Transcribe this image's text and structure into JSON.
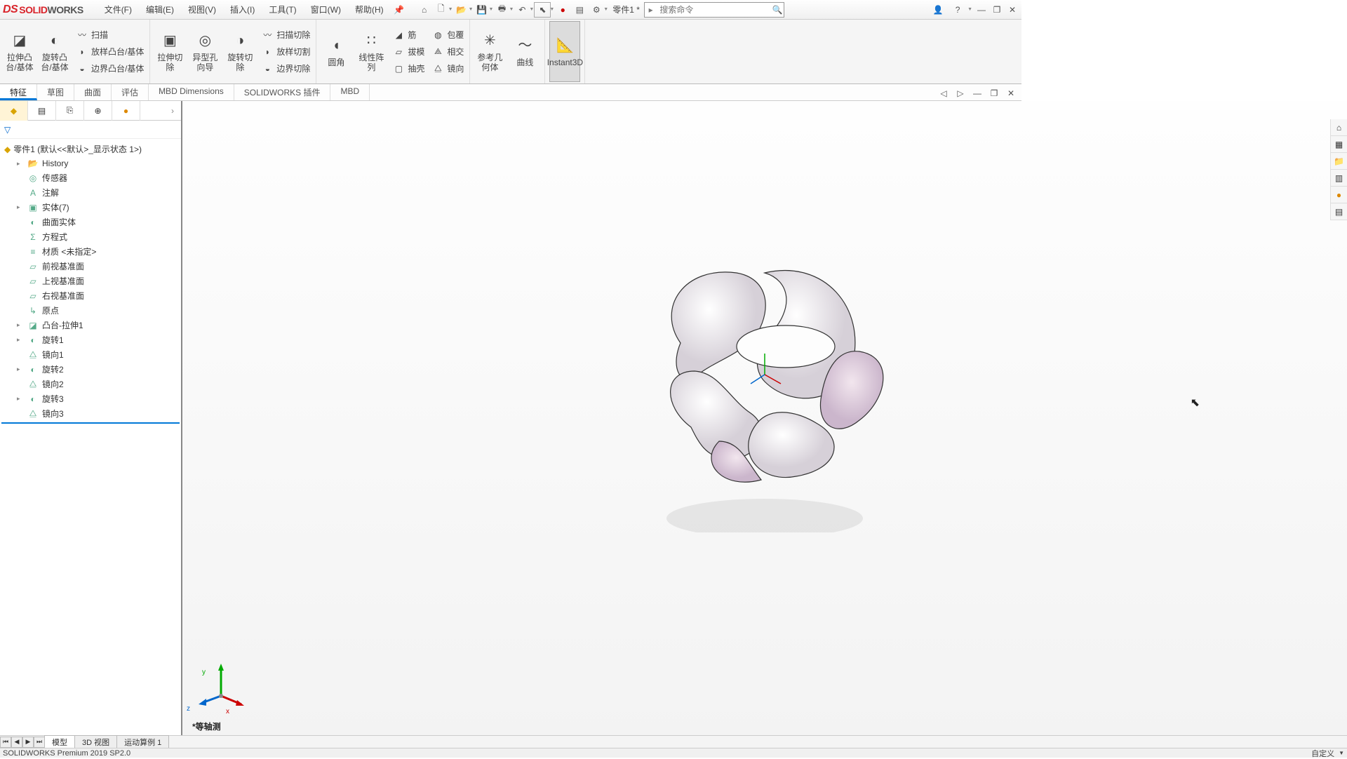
{
  "app": {
    "title": "SOLIDWORKS",
    "title_accent": "SOLID",
    "title_rest": "WORKS"
  },
  "menu": {
    "items": [
      "文件(F)",
      "编辑(E)",
      "视图(V)",
      "插入(I)",
      "工具(T)",
      "窗口(W)",
      "帮助(H)"
    ]
  },
  "doc_name": "零件1 *",
  "search": {
    "placeholder": "搜索命令"
  },
  "ribbon": {
    "big": {
      "extrude": "拉伸凸台/基体",
      "revolve": "旋转凸台/基体",
      "cut_extrude": "拉伸切除",
      "hole_wizard": "异型孔向导",
      "cut_revolve": "旋转切除",
      "fillet": "圆角",
      "linear_pattern": "线性阵列",
      "rib": "筋",
      "draft": "拔模",
      "shell": "抽壳",
      "wrap": "包覆",
      "intersect": "相交",
      "mirror": "镜向",
      "ref_geom": "参考几何体",
      "curves": "曲线",
      "instant3d": "Instant3D"
    },
    "small": {
      "sweep": "扫描",
      "loft": "放样凸台/基体",
      "boundary": "边界凸台/基体",
      "sweep_cut": "扫描切除",
      "loft_cut": "放样切割",
      "boundary_cut": "边界切除"
    }
  },
  "ribbon_tabs": [
    "特征",
    "草图",
    "曲面",
    "评估",
    "MBD Dimensions",
    "SOLIDWORKS 插件",
    "MBD"
  ],
  "tree": {
    "root": "零件1 (默认<<默认>_显示状态 1>)",
    "items": [
      {
        "label": "History",
        "chev": true
      },
      {
        "label": "传感器"
      },
      {
        "label": "注解"
      },
      {
        "label": "实体(7)",
        "chev": true
      },
      {
        "label": "曲面实体"
      },
      {
        "label": "方程式"
      },
      {
        "label": "材质 <未指定>"
      },
      {
        "label": "前视基准面"
      },
      {
        "label": "上视基准面"
      },
      {
        "label": "右视基准面"
      },
      {
        "label": "原点"
      },
      {
        "label": "凸台-拉伸1",
        "chev": true
      },
      {
        "label": "旋转1",
        "chev": true
      },
      {
        "label": "镜向1"
      },
      {
        "label": "旋转2",
        "chev": true
      },
      {
        "label": "镜向2"
      },
      {
        "label": "旋转3",
        "chev": true
      },
      {
        "label": "镜向3"
      }
    ]
  },
  "viewport": {
    "iso_label": "*等轴测"
  },
  "bottom_tabs": [
    "模型",
    "3D 视图",
    "运动算例 1"
  ],
  "status": {
    "left": "SOLIDWORKS Premium 2019 SP2.0",
    "right_mode": "自定义"
  },
  "triad": {
    "x": "x",
    "y": "y",
    "z": "z"
  }
}
